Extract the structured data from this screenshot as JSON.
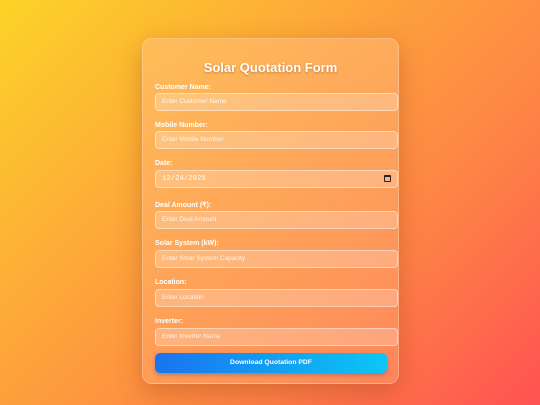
{
  "form": {
    "title": "Solar Quotation Form",
    "fields": [
      {
        "label": "Customer Name:",
        "placeholder": "Enter Customer Name"
      },
      {
        "label": "Mobile Number:",
        "placeholder": "Enter Mobile Number"
      },
      {
        "label": "Date:",
        "value": "12/24/2025"
      },
      {
        "label": "Deal Amount (₹):",
        "placeholder": "Enter Deal Amount"
      },
      {
        "label": "Solar System (kW):",
        "placeholder": "Enter Solar System Capacity"
      },
      {
        "label": "Location:",
        "placeholder": "Enter Location"
      },
      {
        "label": "Inverter:",
        "placeholder": "Enter Inverter Name"
      }
    ],
    "button_label": "Download Quotation PDF"
  },
  "colors": {
    "button_start": "#1a73f0",
    "button_end": "#0bc7f5"
  },
  "icons": {
    "date_picker": "calendar-icon"
  }
}
